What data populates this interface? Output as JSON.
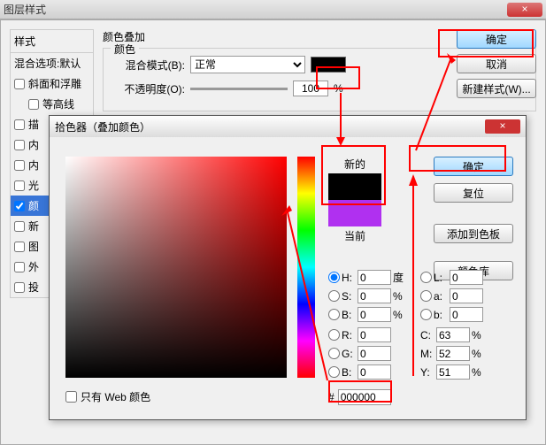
{
  "window": {
    "title": "图层样式",
    "close": "×"
  },
  "sidebar": {
    "header": "样式",
    "blend_default": "混合选项:默认",
    "items": [
      {
        "label": "斜面和浮雕",
        "checked": false
      },
      {
        "label": "等高线",
        "checked": false,
        "sub": true
      },
      {
        "label": "描",
        "checked": false
      },
      {
        "label": "内",
        "checked": false
      },
      {
        "label": "内",
        "checked": false
      },
      {
        "label": "光",
        "checked": false
      },
      {
        "label": "颜",
        "checked": true,
        "selected": true
      },
      {
        "label": "新",
        "checked": false
      },
      {
        "label": "图",
        "checked": false
      },
      {
        "label": "外",
        "checked": false
      },
      {
        "label": "投",
        "checked": false
      }
    ]
  },
  "overlay": {
    "group_title": "颜色叠加",
    "color_title": "颜色",
    "blend_label": "混合模式(B):",
    "blend_value": "正常",
    "opacity_label": "不透明度(O):",
    "opacity_value": "100",
    "percent": "%"
  },
  "buttons": {
    "ok": "确定",
    "cancel": "取消",
    "new_style": "新建样式(W)..."
  },
  "picker": {
    "title": "拾色器（叠加颜色）",
    "close": "×",
    "new_label": "新的",
    "current_label": "当前",
    "ok": "确定",
    "reset": "复位",
    "add_swatch": "添加到色板",
    "color_lib": "颜色库",
    "web_only": "只有 Web 颜色",
    "H": "H:",
    "Hv": "0",
    "Hu": "度",
    "S": "S:",
    "Sv": "0",
    "Su": "%",
    "B": "B:",
    "Bv": "0",
    "Bu": "%",
    "R": "R:",
    "Rv": "0",
    "G": "G:",
    "Gv": "0",
    "Bl": "B:",
    "Blv": "0",
    "L": "L:",
    "Lv": "0",
    "a": "a:",
    "av": "0",
    "b": "b:",
    "bv": "0",
    "C": "C:",
    "Cv": "63",
    "Cu": "%",
    "M": "M:",
    "Mv": "52",
    "Mu": "%",
    "Y": "Y:",
    "Yv": "51",
    "Yu": "%",
    "hash": "#",
    "hex": "000000"
  }
}
